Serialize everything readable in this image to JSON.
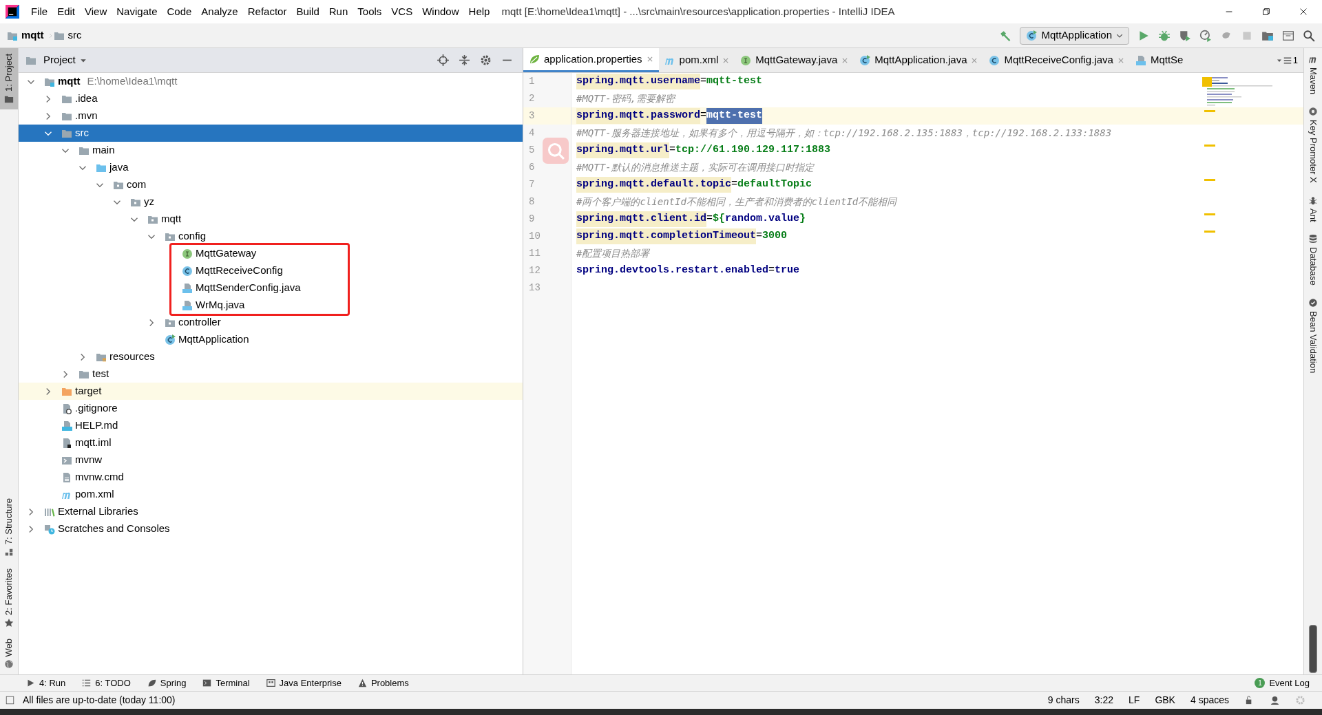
{
  "window": {
    "title": "mqtt [E:\\home\\Idea1\\mqtt] - ...\\src\\main\\resources\\application.properties - IntelliJ IDEA"
  },
  "menu": [
    "File",
    "Edit",
    "View",
    "Navigate",
    "Code",
    "Analyze",
    "Refactor",
    "Build",
    "Run",
    "Tools",
    "VCS",
    "Window",
    "Help"
  ],
  "breadcrumbs": [
    {
      "label": "mqtt",
      "kind": "module"
    },
    {
      "label": "src",
      "kind": "folder"
    }
  ],
  "run_config": {
    "label": "MqttApplication"
  },
  "left_strip": [
    {
      "label": "1: Project",
      "kind": "project",
      "selected": true
    },
    {
      "label": "7: Structure",
      "kind": "structure",
      "selected": false
    },
    {
      "label": "2: Favorites",
      "kind": "favorites",
      "selected": false
    },
    {
      "label": "Web",
      "kind": "web",
      "selected": false
    }
  ],
  "right_strip": [
    {
      "label": "Maven",
      "kind": "maven"
    },
    {
      "label": "Key Promoter X",
      "kind": "promoter"
    },
    {
      "label": "Ant",
      "kind": "ant"
    },
    {
      "label": "Database",
      "kind": "database"
    },
    {
      "label": "Bean Validation",
      "kind": "bean"
    }
  ],
  "project_panel": {
    "title": "Project",
    "tree": [
      {
        "label": "mqtt",
        "hint": "E:\\home\\Idea1\\mqtt",
        "kind": "module",
        "expanded": true,
        "selected": false,
        "children": [
          {
            "label": ".idea",
            "kind": "folder",
            "expanded": false,
            "selected": false
          },
          {
            "label": ".mvn",
            "kind": "folder",
            "expanded": false,
            "selected": false
          },
          {
            "label": "src",
            "kind": "folder",
            "expanded": true,
            "selected": true,
            "children": [
              {
                "label": "main",
                "kind": "folder",
                "expanded": true,
                "selected": false,
                "children": [
                  {
                    "label": "java",
                    "kind": "source-folder",
                    "expanded": true,
                    "selected": false,
                    "children": [
                      {
                        "label": "com",
                        "kind": "package",
                        "expanded": true,
                        "selected": false,
                        "children": [
                          {
                            "label": "yz",
                            "kind": "package",
                            "expanded": true,
                            "selected": false,
                            "children": [
                              {
                                "label": "mqtt",
                                "kind": "package",
                                "expanded": true,
                                "selected": false,
                                "children": [
                                  {
                                    "label": "config",
                                    "kind": "package",
                                    "expanded": true,
                                    "selected": false,
                                    "boxed": true,
                                    "children": [
                                      {
                                        "label": "MqttGateway",
                                        "kind": "interface",
                                        "selected": false
                                      },
                                      {
                                        "label": "MqttReceiveConfig",
                                        "kind": "class",
                                        "selected": false
                                      },
                                      {
                                        "label": "MqttSenderConfig.java",
                                        "kind": "java-file",
                                        "selected": false
                                      },
                                      {
                                        "label": "WrMq.java",
                                        "kind": "java-file",
                                        "selected": false
                                      }
                                    ]
                                  },
                                  {
                                    "label": "controller",
                                    "kind": "package",
                                    "expanded": false,
                                    "selected": false
                                  },
                                  {
                                    "label": "MqttApplication",
                                    "kind": "spring-class",
                                    "selected": false
                                  }
                                ]
                              }
                            ]
                          }
                        ]
                      }
                    ]
                  },
                  {
                    "label": "resources",
                    "kind": "resources-folder",
                    "expanded": false,
                    "selected": false
                  }
                ]
              },
              {
                "label": "test",
                "kind": "folder",
                "expanded": false,
                "selected": false
              }
            ]
          },
          {
            "label": "target",
            "kind": "excluded-folder",
            "expanded": false,
            "selected": false,
            "highlighted": true
          },
          {
            "label": ".gitignore",
            "kind": "ignore-file",
            "selected": false
          },
          {
            "label": "HELP.md",
            "kind": "md-file",
            "selected": false
          },
          {
            "label": "mqtt.iml",
            "kind": "iml-file",
            "selected": false
          },
          {
            "label": "mvnw",
            "kind": "script-file",
            "selected": false
          },
          {
            "label": "mvnw.cmd",
            "kind": "text-file",
            "selected": false
          },
          {
            "label": "pom.xml",
            "kind": "maven-file",
            "selected": false
          }
        ]
      },
      {
        "label": "External Libraries",
        "kind": "libraries",
        "expanded": false,
        "selected": false
      },
      {
        "label": "Scratches and Consoles",
        "kind": "scratches",
        "expanded": false,
        "selected": false
      }
    ]
  },
  "editor": {
    "tabs": [
      {
        "label": "application.properties",
        "kind": "spring",
        "selected": true
      },
      {
        "label": "pom.xml",
        "kind": "maven",
        "selected": false
      },
      {
        "label": "MqttGateway.java",
        "kind": "interface",
        "selected": false
      },
      {
        "label": "MqttApplication.java",
        "kind": "spring-class",
        "selected": false
      },
      {
        "label": "MqttReceiveConfig.java",
        "kind": "class",
        "selected": false
      },
      {
        "label": "MqttSe",
        "kind": "java-file",
        "selected": false
      }
    ],
    "tab_overflow": "1",
    "lines": [
      {
        "number": "1",
        "current": false,
        "tokens": [
          {
            "text": "spring.mqtt.username",
            "kind": "key",
            "highlighted": true
          },
          {
            "text": "=",
            "kind": "sep"
          },
          {
            "text": "mqtt-test",
            "kind": "value",
            "selected": false
          }
        ]
      },
      {
        "number": "2",
        "current": false,
        "tokens": [
          {
            "text": "#MQTT-密码,需要解密",
            "kind": "comment"
          }
        ]
      },
      {
        "number": "3",
        "current": true,
        "tokens": [
          {
            "text": "spring.mqtt.password",
            "kind": "key",
            "highlighted": true
          },
          {
            "text": "=",
            "kind": "sep"
          },
          {
            "text": "mqtt-test",
            "kind": "value",
            "selected": true
          }
        ]
      },
      {
        "number": "4",
        "current": false,
        "tokens": [
          {
            "text": "#MQTT-服务器连接地址，如果有多个，用逗号隔开，如：tcp://192.168.2.135:1883，tcp://192.168.2.133:1883",
            "kind": "comment"
          }
        ]
      },
      {
        "number": "5",
        "current": false,
        "tokens": [
          {
            "text": "spring.mqtt.url",
            "kind": "key",
            "highlighted": true
          },
          {
            "text": "=",
            "kind": "sep"
          },
          {
            "text": "tcp://61.190.129.117:1883",
            "kind": "value",
            "selected": false
          }
        ]
      },
      {
        "number": "6",
        "current": false,
        "tokens": [
          {
            "text": "#MQTT-默认的消息推送主题，实际可在调用接口时指定",
            "kind": "comment"
          }
        ]
      },
      {
        "number": "7",
        "current": false,
        "tokens": [
          {
            "text": "spring.mqtt.default.topic",
            "kind": "key",
            "highlighted": true
          },
          {
            "text": "=",
            "kind": "sep"
          },
          {
            "text": "defaultTopic",
            "kind": "value",
            "selected": false
          }
        ]
      },
      {
        "number": "8",
        "current": false,
        "tokens": [
          {
            "text": "#两个客户端的clientId不能相同，生产者和消费者的clientId不能相同",
            "kind": "comment"
          }
        ]
      },
      {
        "number": "9",
        "current": false,
        "tokens": [
          {
            "text": "spring.mqtt.client.id",
            "kind": "key",
            "highlighted": true
          },
          {
            "text": "=",
            "kind": "sep"
          },
          {
            "text": "${",
            "kind": "value",
            "selected": false
          },
          {
            "text": "random.value",
            "kind": "reference"
          },
          {
            "text": "}",
            "kind": "value",
            "selected": false
          }
        ]
      },
      {
        "number": "10",
        "current": false,
        "tokens": [
          {
            "text": "spring.mqtt.completionTimeout",
            "kind": "key",
            "highlighted": true
          },
          {
            "text": "=",
            "kind": "sep"
          },
          {
            "text": "3000",
            "kind": "value",
            "selected": false
          }
        ]
      },
      {
        "number": "11",
        "current": false,
        "tokens": [
          {
            "text": "#配置项目热部署",
            "kind": "comment"
          }
        ]
      },
      {
        "number": "12",
        "current": false,
        "tokens": [
          {
            "text": "spring.devtools.restart.enabled",
            "kind": "key",
            "highlighted": false
          },
          {
            "text": "=",
            "kind": "sep"
          },
          {
            "text": "true",
            "kind": "key",
            "highlighted": false
          }
        ]
      },
      {
        "number": "13",
        "current": false
      }
    ]
  },
  "tool_bar": [
    {
      "label": "4: Run",
      "kind": "run"
    },
    {
      "label": "6: TODO",
      "kind": "todo"
    },
    {
      "label": "Spring",
      "kind": "spring"
    },
    {
      "label": "Terminal",
      "kind": "terminal"
    },
    {
      "label": "Java Enterprise",
      "kind": "enterprise"
    },
    {
      "label": "Problems",
      "kind": "problems"
    }
  ],
  "event_log": {
    "label": "Event Log",
    "count": "1"
  },
  "status_bar": {
    "message": "All files are up-to-date (today 11:00)",
    "items": [
      "9 chars",
      "3:22",
      "LF",
      "GBK",
      "4 spaces"
    ]
  }
}
